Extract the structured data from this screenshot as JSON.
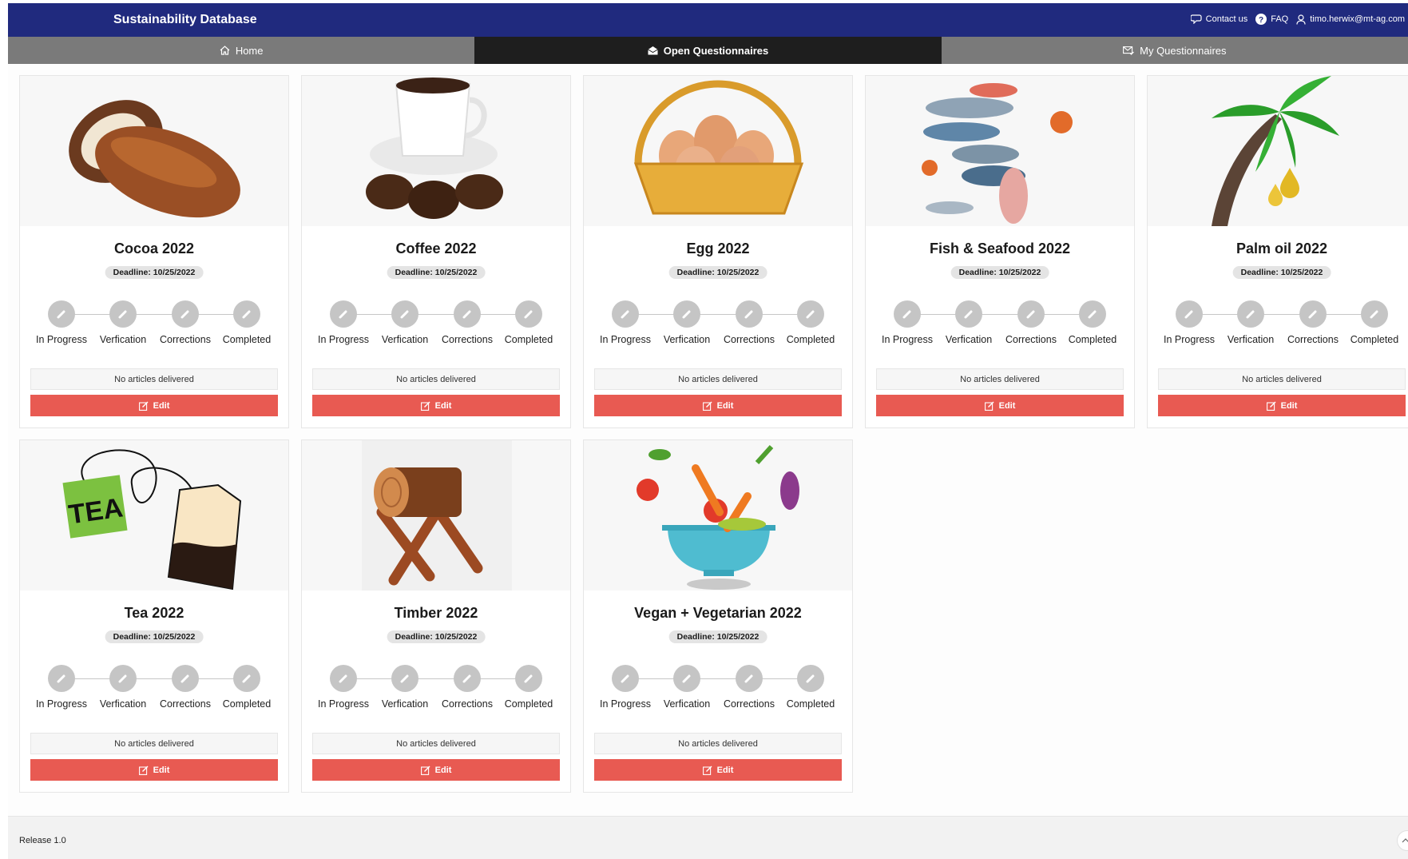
{
  "app": {
    "title": "Sustainability Database"
  },
  "topnav": {
    "contact": "Contact us",
    "faq": "FAQ",
    "user": "timo.herwix@mt-ag.com"
  },
  "tabs": [
    {
      "label": "Home",
      "active": false,
      "icon": "home-icon"
    },
    {
      "label": "Open Questionnaires",
      "active": true,
      "icon": "envelope-open-icon"
    },
    {
      "label": "My Questionnaires",
      "active": false,
      "icon": "mail-check-icon"
    }
  ],
  "steps": [
    "In Progress",
    "Verfication",
    "Corrections",
    "Completed"
  ],
  "cards": [
    {
      "title": "Cocoa 2022",
      "deadline": "Deadline: 10/25/2022",
      "status": "No articles delivered",
      "edit": "Edit",
      "image": "cocoa-pod-image"
    },
    {
      "title": "Coffee 2022",
      "deadline": "Deadline: 10/25/2022",
      "status": "No articles delivered",
      "edit": "Edit",
      "image": "coffee-cup-image"
    },
    {
      "title": "Egg 2022",
      "deadline": "Deadline: 10/25/2022",
      "status": "No articles delivered",
      "edit": "Edit",
      "image": "egg-basket-image"
    },
    {
      "title": "Fish & Seafood 2022",
      "deadline": "Deadline: 10/25/2022",
      "status": "No articles delivered",
      "edit": "Edit",
      "image": "fish-seafood-image"
    },
    {
      "title": "Palm oil 2022",
      "deadline": "Deadline: 10/25/2022",
      "status": "No articles delivered",
      "edit": "Edit",
      "image": "palm-tree-image"
    },
    {
      "title": "Tea 2022",
      "deadline": "Deadline: 10/25/2022",
      "status": "No articles delivered",
      "edit": "Edit",
      "image": "tea-bag-image"
    },
    {
      "title": "Timber 2022",
      "deadline": "Deadline: 10/25/2022",
      "status": "No articles delivered",
      "edit": "Edit",
      "image": "timber-log-image"
    },
    {
      "title": "Vegan + Vegetarian 2022",
      "deadline": "Deadline: 10/25/2022",
      "status": "No articles delivered",
      "edit": "Edit",
      "image": "vegetable-bowl-image"
    }
  ],
  "footer": {
    "release": "Release 1.0"
  },
  "colors": {
    "header": "#202a7e",
    "tab": "#7a7a7a",
    "tab_active": "#1e1e1e",
    "edit": "#e85a52",
    "step": "#c5c5c5"
  }
}
